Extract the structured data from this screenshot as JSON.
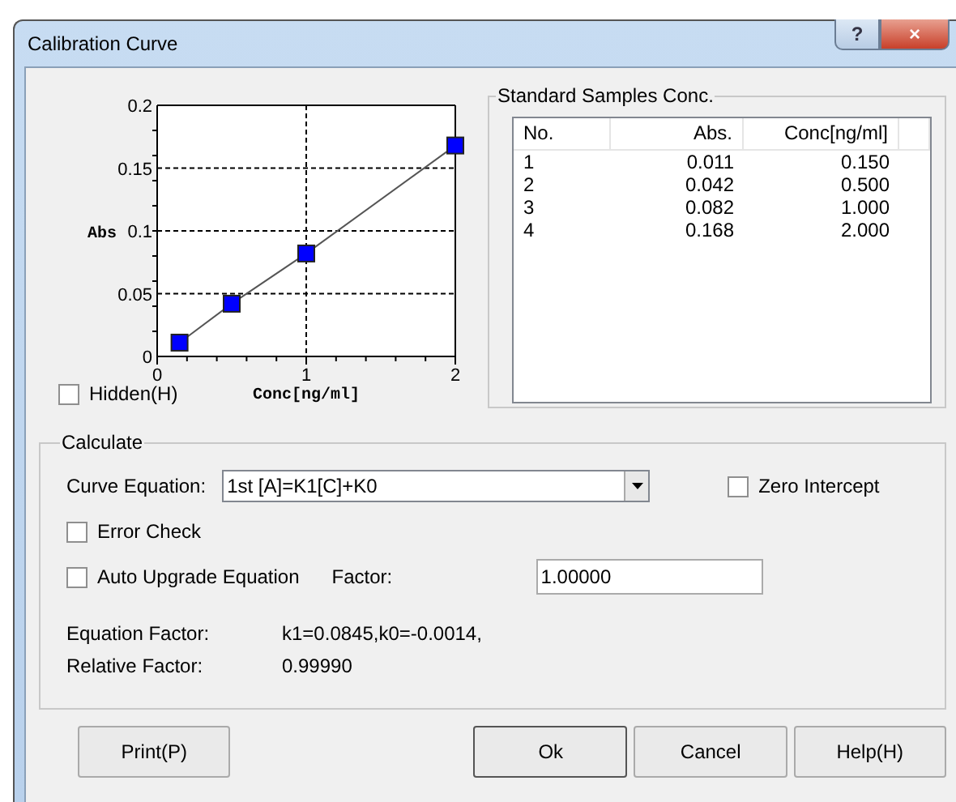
{
  "window": {
    "title": "Calibration Curve",
    "help_button": "?",
    "close_button": "×"
  },
  "chart": {
    "hidden": {
      "label": "Hidden(H)",
      "checked": false
    },
    "chart_data": {
      "type": "line",
      "xlabel": "Conc[ng/ml]",
      "ylabel": "Abs",
      "x": [
        0.15,
        0.5,
        1,
        2
      ],
      "grid": true,
      "series": [
        {
          "color": "#0000ff",
          "marker": "square",
          "values": [
            0.011,
            0.042,
            0.082,
            0.168
          ]
        }
      ],
      "xlim": [
        0,
        2
      ],
      "ylim": [
        0,
        0.2
      ],
      "xticks": [
        0,
        1,
        2
      ],
      "yticks": [
        0,
        {
          "value": 0.05,
          "label": "0.05"
        },
        {
          "value": 0.1,
          "label": "0.1"
        },
        {
          "value": 0.15,
          "label": "0.15"
        },
        {
          "value": 0.2,
          "label": "0.2"
        }
      ]
    }
  },
  "samples": {
    "title": "Standard Samples Conc.",
    "columns": [
      "No.",
      "Abs.",
      "Conc[ng/ml]"
    ],
    "rows": [
      [
        "1",
        "0.011",
        "0.150"
      ],
      [
        "2",
        "0.042",
        "0.500"
      ],
      [
        "3",
        "0.082",
        "1.000"
      ],
      [
        "4",
        "0.168",
        "2.000"
      ]
    ]
  },
  "calculate": {
    "title": "Calculate",
    "curve_label": "Curve Equation:",
    "curve_value": "1st [A]=K1[C]+K0",
    "zero_intercept": {
      "label": "Zero Intercept",
      "checked": false
    },
    "error_check": {
      "label": "Error Check",
      "checked": false
    },
    "auto_upgrade": {
      "label": "Auto Upgrade Equation",
      "checked": false
    },
    "factor_label": "Factor:",
    "factor_value": "1.00000",
    "equation_factor_label": "Equation Factor:",
    "equation_factor_value": "k1=0.0845,k0=-0.0014,",
    "relative_factor_label": "Relative Factor:",
    "relative_factor_value": "0.99990"
  },
  "buttons": [
    "Print(P)",
    "Ok",
    "Cancel",
    "Help(H)"
  ]
}
